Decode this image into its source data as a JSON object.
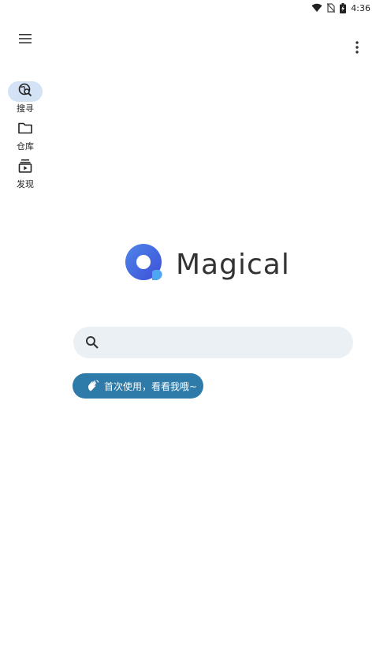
{
  "status_bar": {
    "time": "4:36",
    "icons": [
      "wifi-icon",
      "no-sim-icon",
      "battery-charging-icon"
    ]
  },
  "app_bar": {
    "menu_icon": "hamburger-menu-icon",
    "more_icon": "more-vert-icon"
  },
  "nav_rail": {
    "items": [
      {
        "label": "搜寻",
        "icon": "globe-search-icon",
        "active": true
      },
      {
        "label": "仓库",
        "icon": "folder-icon",
        "active": false
      },
      {
        "label": "发现",
        "icon": "subscriptions-icon",
        "active": false
      }
    ]
  },
  "logo": {
    "text": "Magical",
    "colors": {
      "circle_start": "#4f86e8",
      "circle_end": "#3c4fd9",
      "bubble": "#4fa6f0"
    }
  },
  "search": {
    "value": "",
    "placeholder": "",
    "icon": "search-icon",
    "background": "#eaf0f4"
  },
  "guide_chip": {
    "label": "首次使用，看看我哦~",
    "icon": "waving-hand-icon",
    "background": "#2e7aa8"
  }
}
